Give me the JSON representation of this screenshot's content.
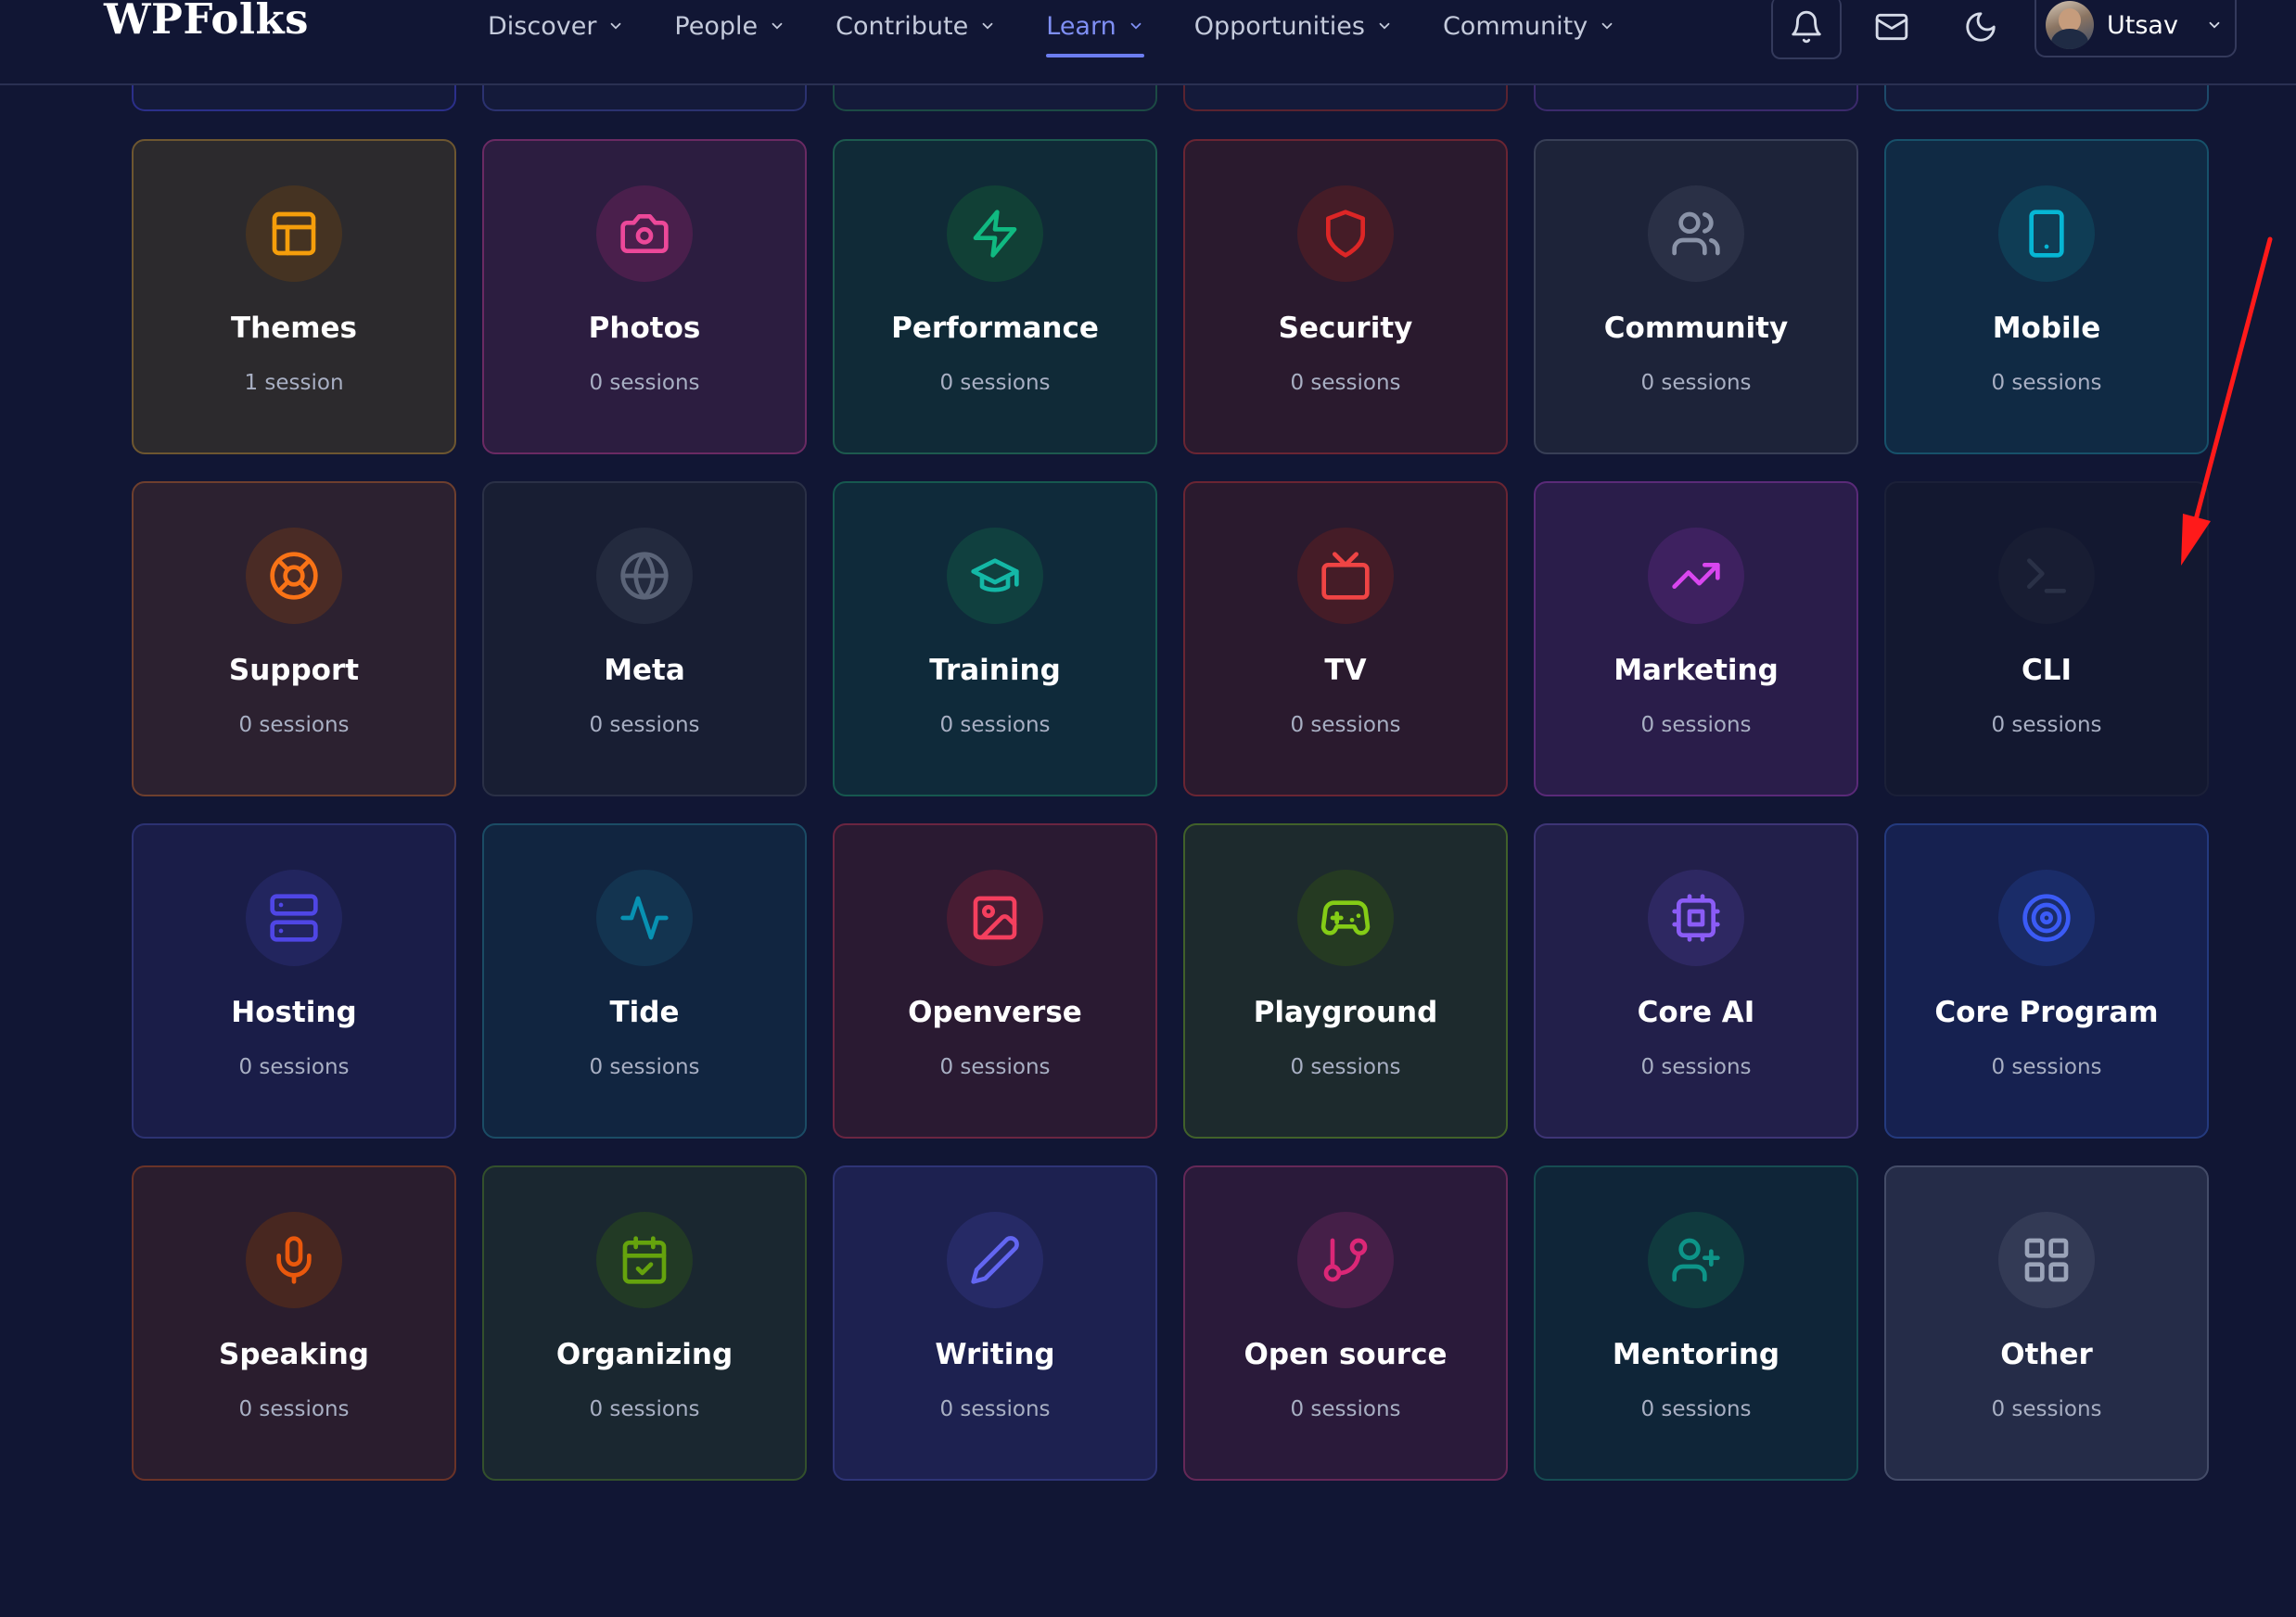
{
  "brand": {
    "logo": "WPFolks"
  },
  "nav": {
    "items": [
      {
        "label": "Discover",
        "active": false
      },
      {
        "label": "People",
        "active": false
      },
      {
        "label": "Contribute",
        "active": false
      },
      {
        "label": "Learn",
        "active": true
      },
      {
        "label": "Opportunities",
        "active": false
      },
      {
        "label": "Community",
        "active": false
      }
    ]
  },
  "header_icons": [
    "bell-icon",
    "mail-icon",
    "moon-icon"
  ],
  "user": {
    "name": "Utsav"
  },
  "peek_colors": [
    "#2b2f8a",
    "#2b3270",
    "#1c4a44",
    "#5a2330",
    "#3b2a6c",
    "#1d4a6a"
  ],
  "cards": [
    {
      "title": "Themes",
      "count": "1 session",
      "icon": "layout-icon",
      "color": "#f59e0b",
      "bg": "#2c2a2d",
      "border": "#6d5630",
      "icbg": "#453322"
    },
    {
      "title": "Photos",
      "count": "0 sessions",
      "icon": "camera-icon",
      "color": "#ec4899",
      "bg": "#2c1d40",
      "border": "#6a2a63",
      "icbg": "#4a1f4c"
    },
    {
      "title": "Performance",
      "count": "0 sessions",
      "icon": "zap-icon",
      "color": "#10b981",
      "bg": "#102a37",
      "border": "#1d5a4e",
      "icbg": "#114036"
    },
    {
      "title": "Security",
      "count": "0 sessions",
      "icon": "shield-icon",
      "color": "#dc2626",
      "bg": "#2a1a2e",
      "border": "#6a2533",
      "icbg": "#451c27"
    },
    {
      "title": "Community",
      "count": "0 sessions",
      "icon": "users-icon",
      "color": "#8a93a8",
      "bg": "#1d2339",
      "border": "#383f56",
      "icbg": "#2a3046"
    },
    {
      "title": "Mobile",
      "count": "0 sessions",
      "icon": "smartphone-icon",
      "color": "#06b6d4",
      "bg": "#102a44",
      "border": "#17516a",
      "icbg": "#0f3d55"
    },
    {
      "title": "Support",
      "count": "0 sessions",
      "icon": "life-buoy-icon",
      "color": "#f97316",
      "bg": "#2c2130",
      "border": "#6e3f2e",
      "icbg": "#4a2b25"
    },
    {
      "title": "Meta",
      "count": "0 sessions",
      "icon": "globe-icon",
      "color": "#5b6478",
      "bg": "#181e33",
      "border": "#2a3046",
      "icbg": "#232a3e"
    },
    {
      "title": "Training",
      "count": "0 sessions",
      "icon": "graduation-cap-icon",
      "color": "#14b8a6",
      "bg": "#0f2a3a",
      "border": "#16584f",
      "icbg": "#10403f"
    },
    {
      "title": "TV",
      "count": "0 sessions",
      "icon": "tv-icon",
      "color": "#ef4444",
      "bg": "#2a1a2e",
      "border": "#6a2533",
      "icbg": "#451c27"
    },
    {
      "title": "Marketing",
      "count": "0 sessions",
      "icon": "trending-up-icon",
      "color": "#d946ef",
      "bg": "#2a1d4a",
      "border": "#5a2a78",
      "icbg": "#3e2160"
    },
    {
      "title": "CLI",
      "count": "0 sessions",
      "icon": "terminal-icon",
      "color": "#2a3147",
      "bg": "#131830",
      "border": "#1b2038",
      "icbg": "#181d33"
    },
    {
      "title": "Hosting",
      "count": "0 sessions",
      "icon": "server-icon",
      "color": "#4f46e5",
      "bg": "#1a1d48",
      "border": "#2c3272",
      "icbg": "#22255e"
    },
    {
      "title": "Tide",
      "count": "0 sessions",
      "icon": "activity-icon",
      "color": "#0891b2",
      "bg": "#112540",
      "border": "#1b4c65",
      "icbg": "#133450"
    },
    {
      "title": "Openverse",
      "count": "0 sessions",
      "icon": "image-icon",
      "color": "#f43f5e",
      "bg": "#2a1a32",
      "border": "#6a2541",
      "icbg": "#481c33"
    },
    {
      "title": "Playground",
      "count": "0 sessions",
      "icon": "gamepad-icon",
      "color": "#84cc16",
      "bg": "#1d2a2d",
      "border": "#41612a",
      "icbg": "#253a22"
    },
    {
      "title": "Core AI",
      "count": "0 sessions",
      "icon": "cpu-icon",
      "color": "#8b5cf6",
      "bg": "#221f4a",
      "border": "#3e3576",
      "icbg": "#2e2862"
    },
    {
      "title": "Core Program",
      "count": "0 sessions",
      "icon": "target-icon",
      "color": "#3b5bf6",
      "bg": "#162150",
      "border": "#243a7e",
      "icbg": "#1a2c68"
    },
    {
      "title": "Speaking",
      "count": "0 sessions",
      "icon": "mic-icon",
      "color": "#ea580c",
      "bg": "#2a1d2e",
      "border": "#6a3328",
      "icbg": "#482720"
    },
    {
      "title": "Organizing",
      "count": "0 sessions",
      "icon": "calendar-check-icon",
      "color": "#65a30d",
      "bg": "#1a2730",
      "border": "#33502c",
      "icbg": "#223a25"
    },
    {
      "title": "Writing",
      "count": "0 sessions",
      "icon": "pencil-icon",
      "color": "#6366f1",
      "bg": "#1d2150",
      "border": "#2e3476",
      "icbg": "#262a66"
    },
    {
      "title": "Open source",
      "count": "0 sessions",
      "icon": "git-branch-icon",
      "color": "#db2777",
      "bg": "#2a1a3a",
      "border": "#652857",
      "icbg": "#451f48"
    },
    {
      "title": "Mentoring",
      "count": "0 sessions",
      "icon": "user-plus-icon",
      "color": "#0d9488",
      "bg": "#0f2538",
      "border": "#164c52",
      "icbg": "#103a3e"
    },
    {
      "title": "Other",
      "count": "0 sessions",
      "icon": "grid-icon",
      "color": "#9aa3b8",
      "bg": "#252c48",
      "border": "#444c68",
      "icbg": "#333a55"
    }
  ],
  "annotation": {
    "arrow_color": "#ff1a1a"
  }
}
